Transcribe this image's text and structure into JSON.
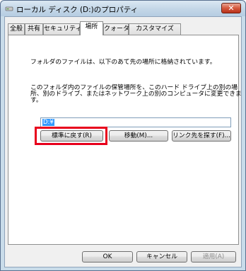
{
  "window": {
    "title": "ローカル ディスク (D:)のプロパティ",
    "close_label": "✕"
  },
  "tabs": [
    "全般",
    "共有",
    "セキュリティ",
    "場所",
    "クォータ",
    "カスタマイズ"
  ],
  "active_tab": "場所",
  "location": {
    "description": "フォルダのファイルは、以下のあて先の場所に格納されています。",
    "instructions": [
      "このフォルダ内のファイルの保管場所を、このハード ドライブ上の別の場",
      "所、別のドライブ、またはネットワーク上の別のコンピュータに変更できま",
      "す。"
    ],
    "path_value": "D:¥",
    "restore_default_label": "標準に戻す(R)",
    "move_label": "移動(M)...",
    "find_target_label": "リンク先を探す(F)..."
  },
  "footer": {
    "ok_label": "OK",
    "cancel_label": "キャンセル",
    "apply_label": "適用(A)"
  },
  "colors": {
    "highlight": "#e8001c",
    "selection": "#3399ff",
    "close_button": "#c8432a"
  }
}
